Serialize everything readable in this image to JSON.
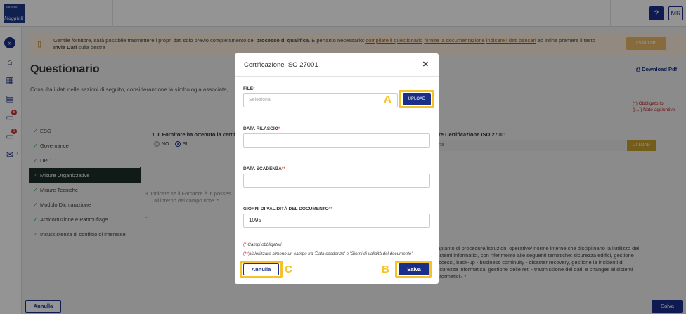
{
  "header": {
    "logo_group": "GRUPPO",
    "logo_name": "Maggioli",
    "help_label": "?",
    "user_initials": "MR"
  },
  "rail": {
    "expand_icon": "chevron-double-right-icon",
    "items": [
      {
        "icon": "home-icon"
      },
      {
        "icon": "building-icon"
      },
      {
        "icon": "clipboard-icon"
      },
      {
        "icon": "folder-icon",
        "badge": "5"
      },
      {
        "icon": "briefcase-icon",
        "badge": "1"
      },
      {
        "icon": "mail-icon"
      }
    ]
  },
  "notice": {
    "text_1": "Gentile fornitore, sarà possibile trasmettere i propri dati solo previo completamento del ",
    "text_bold": "processo di qualifica",
    "text_2": ". È pertanto necessario: ",
    "link_1": "compilare il questionario",
    "link_2": "fornire la documentazione",
    "link_3": "indicare i dati bancari",
    "text_3": " ed infine premere il tasto ",
    "text_bold_2": "Invia Dati",
    "text_4": " sulla destra",
    "button": "Invia Dati"
  },
  "page": {
    "title": "Questionario",
    "description": "Consulta i dati nelle sezioni di seguito, considerandone la simbologia associata,",
    "download": "Download Pdf",
    "legend_1": "(*) Obbligatorio",
    "legend_2": "([...]) Note aggiuntive"
  },
  "nav": {
    "items": [
      {
        "label": "ESG"
      },
      {
        "label": "Governance"
      },
      {
        "label": "DPO"
      },
      {
        "label": "Misure Organizzative"
      },
      {
        "label": "Misure Tecniche"
      },
      {
        "label": "Modulo Dichiarazione"
      },
      {
        "label": "Anticorruzione e Pantouflage"
      },
      {
        "label": "Insussistenza di conflitto di interesse"
      }
    ]
  },
  "background": {
    "q1_number": "1",
    "q1_text": "Il Fornitore ha ottenuto la certifi",
    "radio_no": "NO",
    "radio_si": "SI",
    "cert_label": "re Certificazione ISO 27001",
    "cert_field": "na",
    "upload_label": "UPLOAD",
    "q2_number": "3",
    "q2_line1": "Indicare se il Fornitore è in posses",
    "q2_line2": "all'interno del campo note. *",
    "dash": "-",
    "long_text": "mpianto di procedure/istruzioni operative/ norme interne che disciplinano la l'utilizzo dei sistemi informatici, con riferimento alle seguenti tematiche: sicurezza edifici, gestione accessi, back-up - business continuity - disaster recovery, gestione la incidenti di sicurezza informatica, gestione delle reti - trasmissione dei dati, e changes ai sistemi informatici? *",
    "cancel": "Annulla",
    "save": "Salva"
  },
  "modal": {
    "title": "Certificazione ISO 27001",
    "file_label": "FILE",
    "file_placeholder": "Seleziona",
    "upload": "UPLOAD",
    "data_rilascio_label": "DATA RILASCIO",
    "data_scadenza_label": "DATA SCADENZA",
    "giorni_label": "GIORNI DI VALIDITÀ DEL DOCUMENTO",
    "giorni_value": "1095",
    "req_single": "*",
    "req_double": "**",
    "note_1_marker": "(*)",
    "note_1": "Campi obbligatori",
    "note_2_marker": "(**)",
    "note_2": "Valorizzare almeno un campo tra 'Data scadenza' e 'Giorni di validità del documento'",
    "cancel": "Annulla",
    "save": "Salva"
  },
  "annotations": {
    "a": "A",
    "b": "B",
    "c": "C",
    "color": "#f5c22a"
  },
  "colors": {
    "primary": "#1a2f8a",
    "notice_bg": "#fbeedd",
    "active_nav": "#1c2f2a"
  }
}
